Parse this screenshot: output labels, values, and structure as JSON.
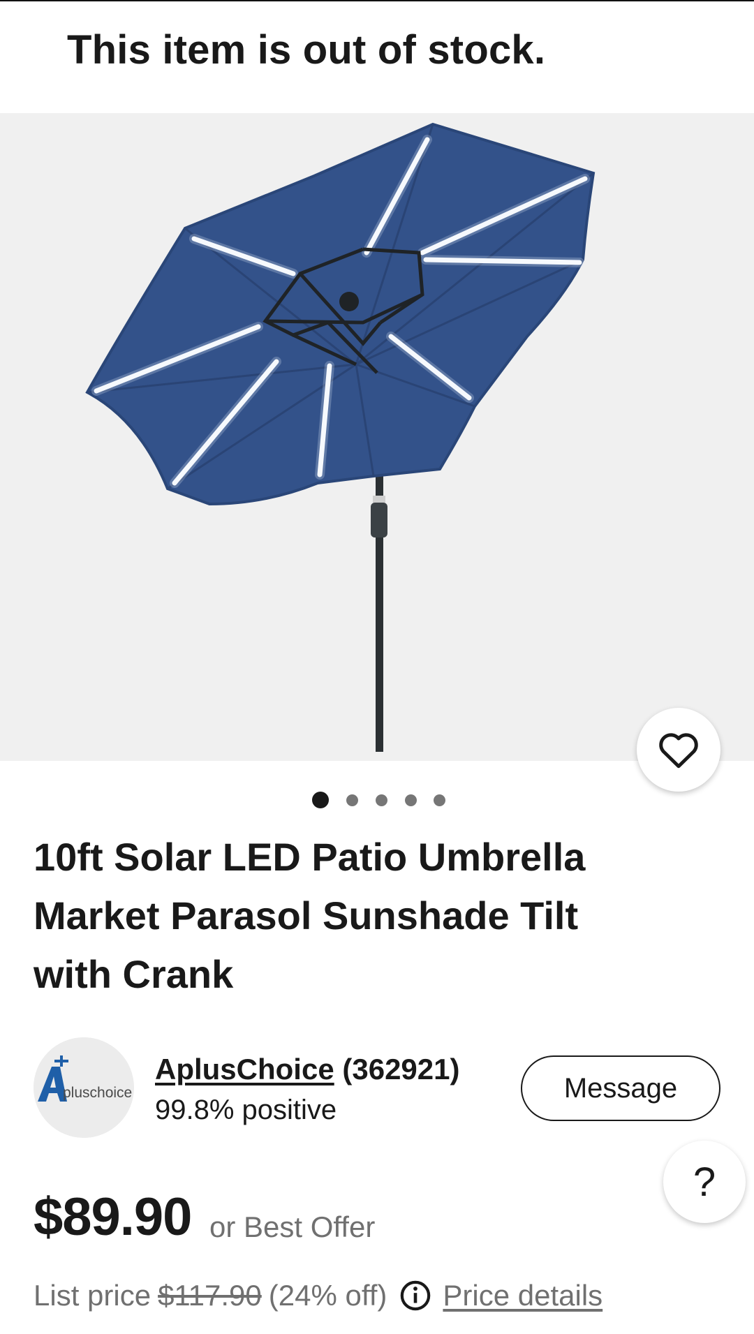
{
  "banner": {
    "text": "This item is out of stock."
  },
  "gallery": {
    "image_count": 5,
    "active_index": 0
  },
  "listing": {
    "title": "10ft Solar LED Patio Umbrella Market Parasol Sunshade Tilt with Crank"
  },
  "seller": {
    "logo_text": "pluschoice",
    "name": "AplusChoice",
    "feedback_count": "(362921)",
    "feedback_percent": "99.8% positive",
    "message_label": "Message"
  },
  "help": {
    "label": "?"
  },
  "pricing": {
    "price": "$89.90",
    "best_offer": "or Best Offer",
    "list_price_label": "List price",
    "list_price": "$117.90",
    "discount": "(24% off)",
    "price_details_label": "Price details"
  },
  "colors": {
    "umbrella_canopy": "#33528a",
    "led_strip": "#ffffff",
    "text_primary": "#191919",
    "text_secondary": "#707070",
    "image_bg": "#f0f0f0"
  },
  "icons": {
    "watch": "heart-icon",
    "info": "info-icon",
    "help": "question-mark-icon"
  }
}
